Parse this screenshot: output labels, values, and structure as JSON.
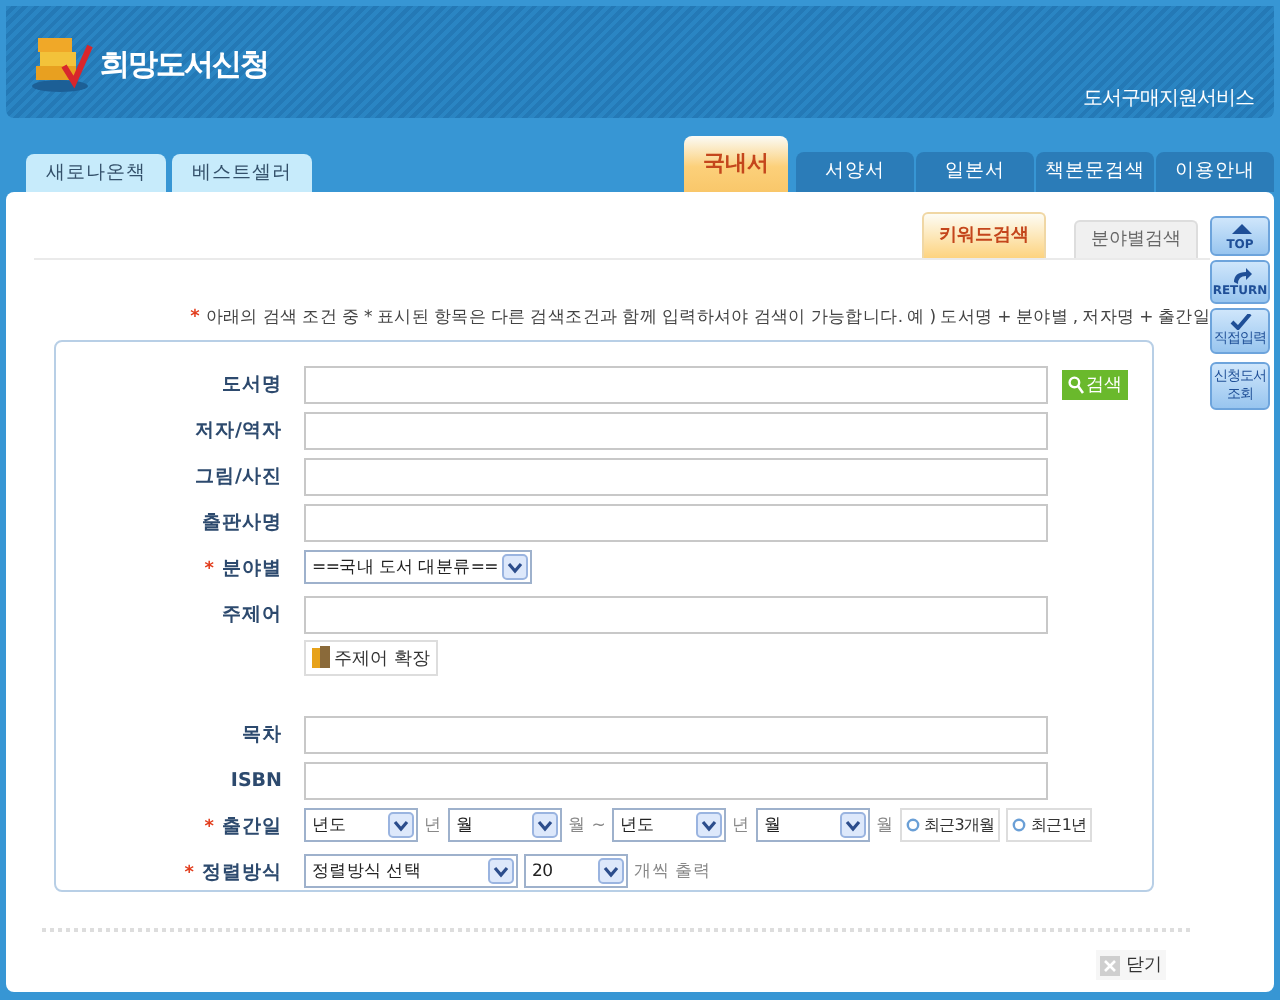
{
  "header": {
    "title": "희망도서신청",
    "subtitle": "도서구매지원서비스"
  },
  "left_tabs": [
    {
      "label": "새로나온책",
      "selected": false
    },
    {
      "label": "베스트셀러",
      "selected": false
    }
  ],
  "main_tabs": [
    {
      "label": "국내서",
      "selected": true
    },
    {
      "label": "서양서",
      "selected": false
    },
    {
      "label": "일본서",
      "selected": false
    },
    {
      "label": "책본문검색",
      "selected": false
    },
    {
      "label": "이용안내",
      "selected": false
    }
  ],
  "sub_tabs": [
    {
      "label": "키워드검색",
      "selected": true
    },
    {
      "label": "분야별검색",
      "selected": false
    }
  ],
  "side_buttons": [
    {
      "kind": "top",
      "label": "TOP"
    },
    {
      "kind": "return",
      "label": "RETURN"
    },
    {
      "kind": "check",
      "label": "직접입력"
    },
    {
      "kind": "text",
      "label": "신청도서 조회"
    }
  ],
  "notice": {
    "marker": "*",
    "text": "아래의 검색 조건 중 * 표시된 항목은 다른 검색조건과 함께 입력하셔야 검색이 가능합니다. 예 ) 도서명 + 분야별 , 저자명 + 출간일"
  },
  "form_rows": [
    {
      "label": "도서명",
      "controls": [
        {
          "kind": "input"
        },
        {
          "kind": "search-button",
          "label": "검색"
        }
      ]
    },
    {
      "label": "저자/역자",
      "controls": [
        {
          "kind": "input"
        }
      ]
    },
    {
      "label": "그림/사진",
      "controls": [
        {
          "kind": "input"
        }
      ]
    },
    {
      "label": "출판사명",
      "controls": [
        {
          "kind": "input"
        }
      ]
    },
    {
      "marker": "*",
      "label": "분야별",
      "controls": [
        {
          "kind": "select-long",
          "value": "==국내 도서 대분류=="
        }
      ]
    },
    {
      "label": "주제어",
      "controls": [
        {
          "kind": "input-line"
        },
        {
          "kind": "expand-button",
          "label": "주제어 확장"
        }
      ]
    },
    {
      "label": "목차",
      "controls": [
        {
          "kind": "input"
        }
      ]
    },
    {
      "label": "ISBN",
      "controls": [
        {
          "kind": "input"
        }
      ]
    },
    {
      "marker": "*",
      "label": "출간일",
      "controls": [
        {
          "kind": "select",
          "value": "년도"
        },
        {
          "kind": "unit",
          "text": "년"
        },
        {
          "kind": "select",
          "value": "월"
        },
        {
          "kind": "unit",
          "text": "월 ~"
        },
        {
          "kind": "select",
          "value": "년도"
        },
        {
          "kind": "unit",
          "text": "년"
        },
        {
          "kind": "select",
          "value": "월"
        },
        {
          "kind": "unit",
          "text": "월"
        },
        {
          "kind": "period-button",
          "label": "최근3개월"
        },
        {
          "kind": "period-button",
          "label": "최근1년"
        }
      ]
    },
    {
      "marker": "*",
      "label": "정렬방식",
      "controls": [
        {
          "kind": "select-long",
          "value": "정렬방식 선택"
        },
        {
          "kind": "select-short",
          "value": "20"
        },
        {
          "kind": "unit",
          "text": "개씩 출력"
        }
      ]
    }
  ],
  "close_button": {
    "label": "닫기"
  }
}
